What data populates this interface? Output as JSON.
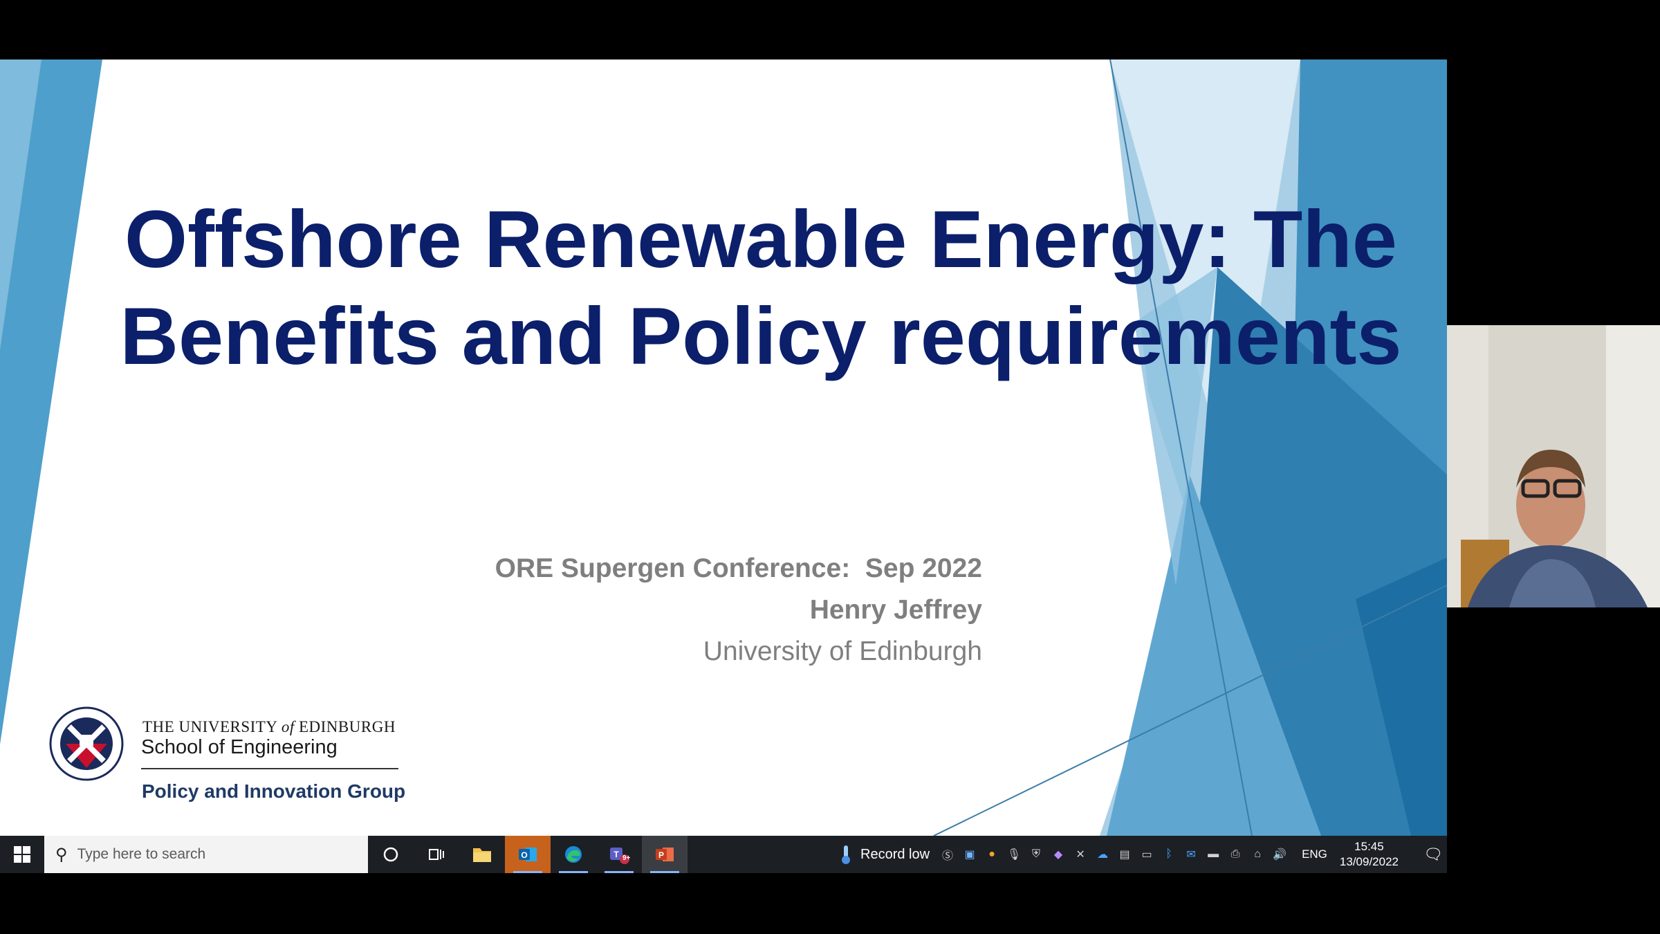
{
  "slide": {
    "title_line1": "Offshore Renewable Energy: The",
    "title_line2": "Benefits and Policy requirements",
    "conference": "ORE Supergen Conference:  Sep 2022",
    "presenter": "Henry Jeffrey",
    "affiliation": "University of Edinburgh",
    "logo": {
      "university_pre": "THE UNIVERSITY ",
      "university_of": "of",
      "university_post": " EDINBURGH",
      "school": "School of Engineering",
      "group": "Policy and Innovation Group"
    }
  },
  "taskbar": {
    "search_placeholder": "Type here to search",
    "weather": "Record low",
    "language": "ENG",
    "time": "15:45",
    "date": "13/09/2022",
    "teams_badge": "9+",
    "pinned": [
      "cortana-icon",
      "task-view-icon",
      "file-explorer-icon",
      "outlook-icon",
      "edge-icon",
      "teams-icon",
      "powerpoint-icon"
    ]
  },
  "colors": {
    "title": "#0b1f6b",
    "subtitle": "#7f7f7f",
    "accent_blue": "#4a9cc8",
    "taskbar": "#1c1f24"
  }
}
